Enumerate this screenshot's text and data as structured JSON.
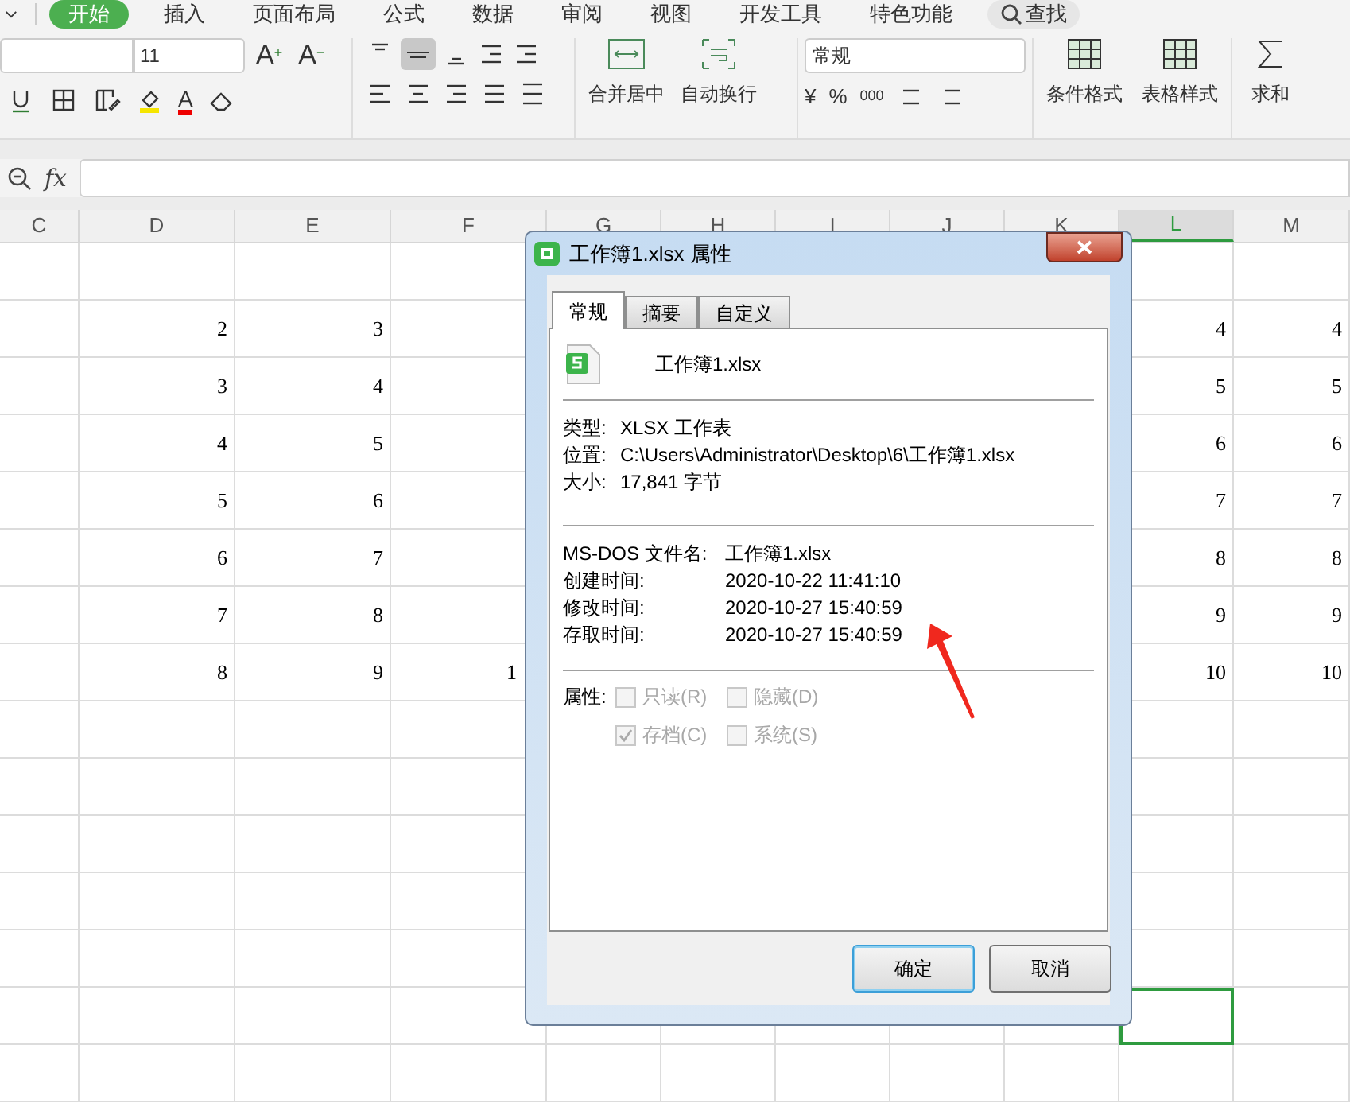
{
  "menu_tabs": [
    {
      "label": "开始",
      "selected": true
    },
    {
      "label": "插入",
      "selected": false
    },
    {
      "label": "页面布局",
      "selected": false
    },
    {
      "label": "公式",
      "selected": false
    },
    {
      "label": "数据",
      "selected": false
    },
    {
      "label": "审阅",
      "selected": false
    },
    {
      "label": "视图",
      "selected": false
    },
    {
      "label": "开发工具",
      "selected": false
    },
    {
      "label": "特色功能",
      "selected": false
    }
  ],
  "search_button": "查找",
  "font_size": "11",
  "font_tools": [
    {
      "label": "A",
      "mark": "+"
    },
    {
      "label": "A",
      "mark": "−"
    }
  ],
  "font_color_button": "A",
  "merge_button": "合并居中",
  "wrap_button": "自动换行",
  "number_format": "常规",
  "number_tools": [
    "¥",
    "%",
    "000"
  ],
  "style_buttons": [
    "条件格式",
    "表格样式",
    "求和"
  ],
  "formula_label": "fx",
  "columns": [
    {
      "label": "C",
      "selected": false
    },
    {
      "label": "D",
      "selected": false
    },
    {
      "label": "E",
      "selected": false
    },
    {
      "label": "F",
      "selected": false,
      "kind": "covered"
    },
    {
      "label": "G",
      "selected": false
    },
    {
      "label": "H",
      "selected": false
    },
    {
      "label": "I",
      "selected": false
    },
    {
      "label": "J",
      "selected": false
    },
    {
      "label": "K",
      "selected": false
    },
    {
      "label": "L",
      "selected": true
    },
    {
      "label": "M",
      "selected": false
    }
  ],
  "rows": [
    {
      "selected": false
    },
    {
      "selected": false,
      "cells": {
        "D": "2",
        "E": "3",
        "L": "4",
        "M": "4"
      }
    },
    {
      "selected": false,
      "cells": {
        "D": "3",
        "E": "4",
        "L": "5",
        "M": "5"
      }
    },
    {
      "selected": false,
      "cells": {
        "D": "4",
        "E": "5",
        "L": "6",
        "M": "6"
      }
    },
    {
      "selected": false,
      "cells": {
        "D": "5",
        "E": "6",
        "L": "7",
        "M": "7"
      }
    },
    {
      "selected": false,
      "cells": {
        "D": "6",
        "E": "7",
        "L": "8",
        "M": "8"
      }
    },
    {
      "selected": false,
      "cells": {
        "D": "7",
        "E": "8",
        "L": "9",
        "M": "9"
      }
    },
    {
      "selected": false,
      "cells": {
        "D": "8",
        "E": "9",
        "F": "1",
        "L": "10",
        "M": "10"
      }
    },
    {
      "selected": false
    },
    {
      "selected": false
    },
    {
      "selected": false
    },
    {
      "selected": false
    },
    {
      "selected": false
    },
    {
      "selected": true
    },
    {
      "selected": false
    }
  ],
  "dialog": {
    "title": "工作簿1.xlsx 属性",
    "tabs": [
      {
        "label": "常规",
        "selected": true
      },
      {
        "label": "摘要",
        "selected": false
      },
      {
        "label": "自定义",
        "selected": false
      }
    ],
    "file_name": "工作簿1.xlsx",
    "info": [
      {
        "label": "类型:",
        "value": "XLSX 工作表"
      },
      {
        "label": "位置:",
        "value": "C:\\Users\\Administrator\\Desktop\\6\\工作簿1.xlsx"
      },
      {
        "label": "大小:",
        "value": "17,841 字节"
      }
    ],
    "details": [
      {
        "label": "MS-DOS 文件名:",
        "value": "工作簿1.xlsx"
      },
      {
        "label": "创建时间:",
        "value": "2020-10-22 11:41:10"
      },
      {
        "label": "修改时间:",
        "value": "2020-10-27 15:40:59"
      },
      {
        "label": "存取时间:",
        "value": "2020-10-27 15:40:59"
      }
    ],
    "attributes_label": "属性:",
    "attributes": [
      {
        "label": "只读(R)",
        "checked": false,
        "disabled": true
      },
      {
        "label": "隐藏(D)",
        "checked": false,
        "disabled": true
      },
      {
        "label": "存档(C)",
        "checked": true,
        "disabled": true
      },
      {
        "label": "系统(S)",
        "checked": false,
        "disabled": true
      }
    ],
    "buttons": [
      {
        "label": "确定",
        "kind": "default"
      },
      {
        "label": "取消",
        "kind": "normal"
      }
    ]
  }
}
